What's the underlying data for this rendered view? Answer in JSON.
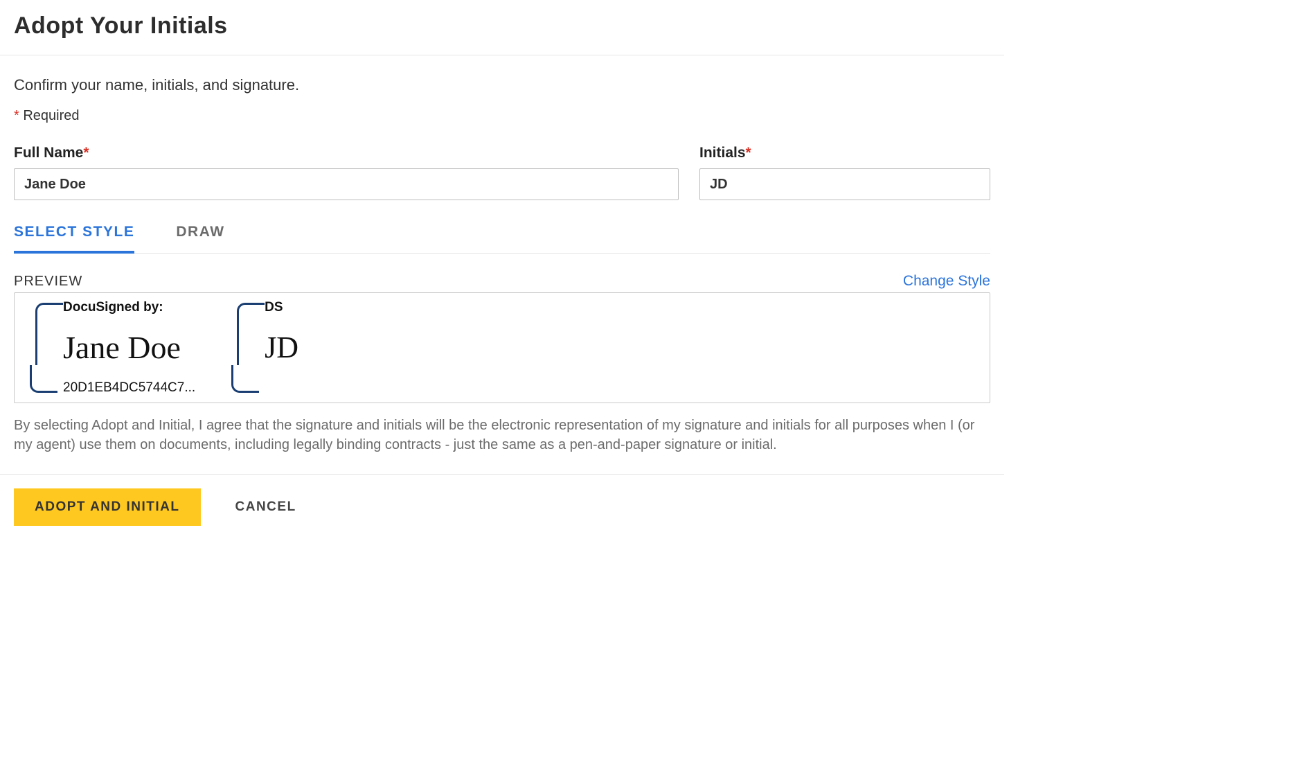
{
  "header": {
    "title": "Adopt Your Initials"
  },
  "instructions": "Confirm your name, initials, and signature.",
  "required_marker": "*",
  "required_text": "Required",
  "fields": {
    "full_name": {
      "label": "Full Name",
      "value": "Jane Doe"
    },
    "initials": {
      "label": "Initials",
      "value": "JD"
    }
  },
  "tabs": {
    "select_style": "SELECT STYLE",
    "draw": "DRAW"
  },
  "preview": {
    "label": "PREVIEW",
    "change_style": "Change Style",
    "signature_prefix": "DocuSigned by:",
    "signature_text": "Jane Doe",
    "signature_id": "20D1EB4DC5744C7...",
    "initials_prefix": "DS",
    "initials_text": "JD"
  },
  "legal": "By selecting Adopt and Initial, I agree that the signature and initials will be the electronic representation of my signature and initials for all purposes when I (or my agent) use them on documents, including legally binding contracts - just the same as a pen-and-paper signature or initial.",
  "buttons": {
    "primary": "ADOPT AND INITIAL",
    "cancel": "CANCEL"
  }
}
